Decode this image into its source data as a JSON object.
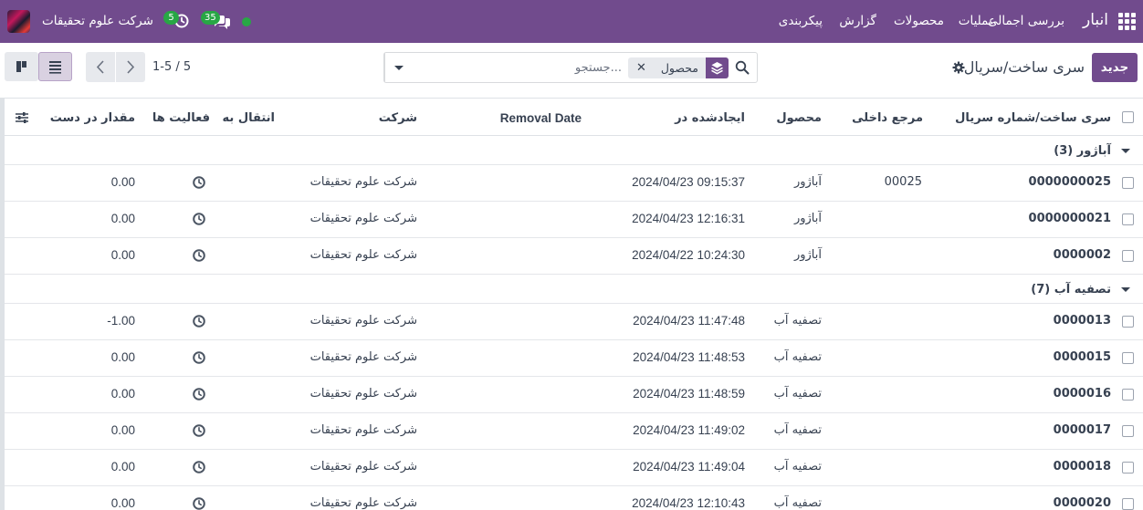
{
  "navbar": {
    "app_name": "انبار",
    "menu": [
      "بررسی اجمالی",
      "عملیات",
      "محصولات",
      "گزارش",
      "پیکربندی"
    ],
    "company": "شرکت علوم تحقیقات",
    "activity_count": "5",
    "messages_count": "35",
    "brand_color": "#714b8d",
    "badge_color": "#28a745"
  },
  "control": {
    "new_button": "جدید",
    "title": "سری ساخت/سریال",
    "search_placeholder": "جستجو...",
    "facet_value": "محصول",
    "facet_remove": "✕",
    "pager": "1-5 / 5"
  },
  "table": {
    "columns": {
      "lot": "سری ساخت/شماره سریال",
      "ref": "مرجع داخلی",
      "product": "محصول",
      "created": "ایجادشده در",
      "removal": "Removal Date",
      "company": "شرکت",
      "transfer": "انتقال به",
      "activities": "فعالیت ها",
      "qty": "مقدار در دست"
    },
    "groups": [
      {
        "title": "آباژور (3)",
        "rows": [
          {
            "lot": "0000000025",
            "ref": "00025",
            "product": "آباژور",
            "created": "2024/04/23 09:15:37",
            "company": "شرکت علوم تحقیقات",
            "qty": "0.00"
          },
          {
            "lot": "0000000021",
            "ref": "",
            "product": "آباژور",
            "created": "2024/04/23 12:16:31",
            "company": "شرکت علوم تحقیقات",
            "qty": "0.00"
          },
          {
            "lot": "0000002",
            "ref": "",
            "product": "آباژور",
            "created": "2024/04/22 10:24:30",
            "company": "شرکت علوم تحقیقات",
            "qty": "0.00"
          }
        ]
      },
      {
        "title": "تصفیه آب (7)",
        "rows": [
          {
            "lot": "0000013",
            "ref": "",
            "product": "تصفیه آب",
            "created": "2024/04/23 11:47:48",
            "company": "شرکت علوم تحقیقات",
            "qty": "-1.00"
          },
          {
            "lot": "0000015",
            "ref": "",
            "product": "تصفیه آب",
            "created": "2024/04/23 11:48:53",
            "company": "شرکت علوم تحقیقات",
            "qty": "0.00"
          },
          {
            "lot": "0000016",
            "ref": "",
            "product": "تصفیه آب",
            "created": "2024/04/23 11:48:59",
            "company": "شرکت علوم تحقیقات",
            "qty": "0.00"
          },
          {
            "lot": "0000017",
            "ref": "",
            "product": "تصفیه آب",
            "created": "2024/04/23 11:49:02",
            "company": "شرکت علوم تحقیقات",
            "qty": "0.00"
          },
          {
            "lot": "0000018",
            "ref": "",
            "product": "تصفیه آب",
            "created": "2024/04/23 11:49:04",
            "company": "شرکت علوم تحقیقات",
            "qty": "0.00"
          },
          {
            "lot": "0000020",
            "ref": "",
            "product": "تصفیه آب",
            "created": "2024/04/23 12:10:43",
            "company": "شرکت علوم تحقیقات",
            "qty": "0.00"
          }
        ]
      }
    ]
  }
}
